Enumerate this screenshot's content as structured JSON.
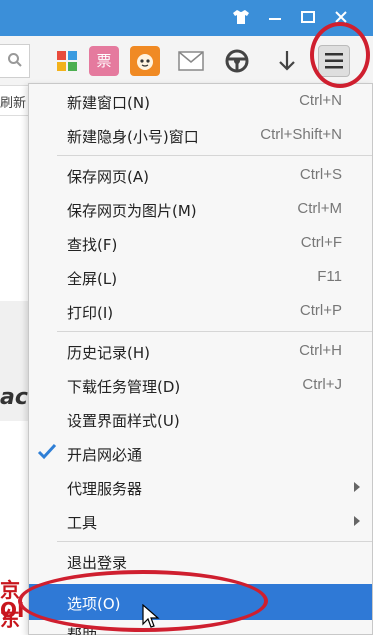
{
  "menu": {
    "items": [
      {
        "label": "新建窗口(N)",
        "shortcut": "Ctrl+N"
      },
      {
        "label": "新建隐身(小号)窗口",
        "shortcut": "Ctrl+Shift+N"
      },
      {
        "label": "保存网页(A)",
        "shortcut": "Ctrl+S"
      },
      {
        "label": "保存网页为图片(M)",
        "shortcut": "Ctrl+M"
      },
      {
        "label": "查找(F)",
        "shortcut": "Ctrl+F"
      },
      {
        "label": "全屏(L)",
        "shortcut": "F11"
      },
      {
        "label": "打印(I)",
        "shortcut": "Ctrl+P"
      },
      {
        "label": "历史记录(H)",
        "shortcut": "Ctrl+H"
      },
      {
        "label": "下载任务管理(D)",
        "shortcut": "Ctrl+J"
      },
      {
        "label": "设置界面样式(U)"
      },
      {
        "label": "开启网必通",
        "checked": true
      },
      {
        "label": "代理服务器",
        "submenu": true
      },
      {
        "label": "工具",
        "submenu": true
      },
      {
        "label": "退出登录"
      },
      {
        "label": "选项(O)",
        "highlighted": true
      },
      {
        "label": "帮助"
      }
    ]
  },
  "page": {
    "snippet_top": "刷新",
    "snippet_mid": "ac",
    "snippet_bottom": "京东",
    "snippet_bottom2": "OI"
  },
  "toolbar": {
    "icons": [
      "search-icon",
      "apps-icon",
      "ticket-icon",
      "pet-icon",
      "mail-icon",
      "steering-wheel-icon",
      "download-icon",
      "menu-icon"
    ],
    "ticket_label": "票"
  },
  "colors": {
    "titlebar": "#3b8fd9",
    "highlight": "#2f79d6",
    "annotation_ring": "#cf1f2f",
    "check": "#2f7fd6"
  }
}
